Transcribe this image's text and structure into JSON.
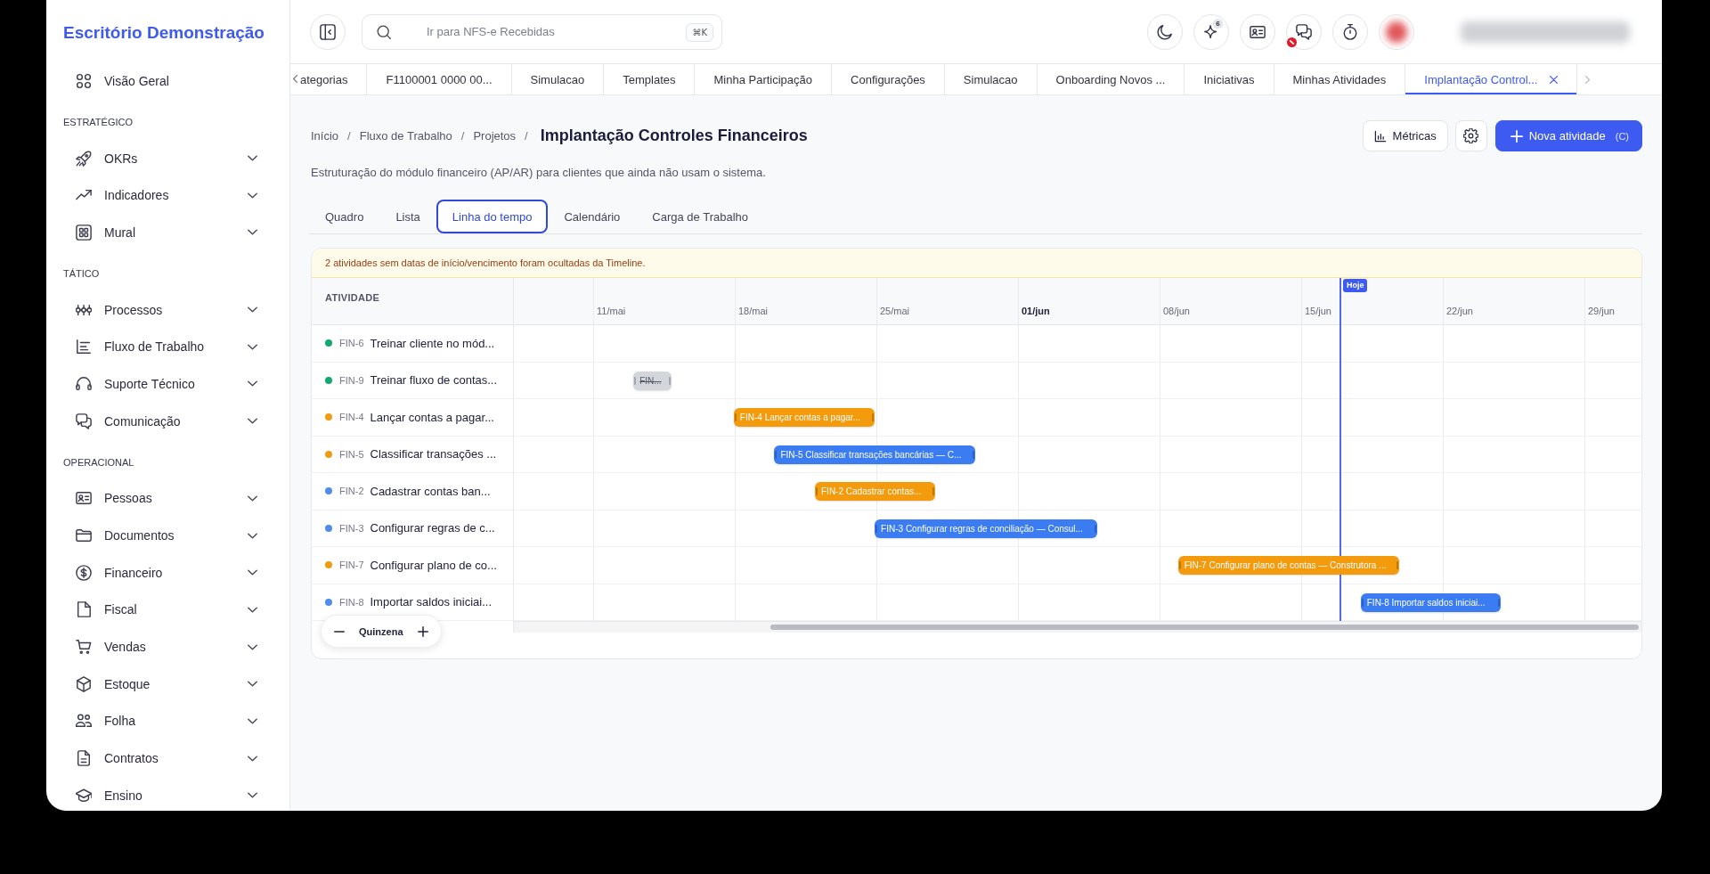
{
  "sidebar": {
    "title": "Escritório Demonstração",
    "groups": [
      {
        "items": [
          {
            "label": "Visão Geral"
          }
        ]
      },
      {
        "label": "ESTRATÉGICO",
        "items": [
          {
            "label": "OKRs",
            "expanded": false
          },
          {
            "label": "Indicadores",
            "expanded": false
          },
          {
            "label": "Mural",
            "expanded": false
          }
        ]
      },
      {
        "label": "TÁTICO",
        "items": [
          {
            "label": "Processos",
            "expanded": false
          },
          {
            "label": "Fluxo de Trabalho",
            "expanded": false
          },
          {
            "label": "Suporte Técnico",
            "expanded": false
          },
          {
            "label": "Comunicação",
            "expanded": false
          }
        ]
      },
      {
        "label": "OPERACIONAL",
        "items": [
          {
            "label": "Pessoas",
            "expanded": false
          },
          {
            "label": "Documentos",
            "expanded": false
          },
          {
            "label": "Financeiro",
            "expanded": false
          },
          {
            "label": "Fiscal",
            "expanded": false
          },
          {
            "label": "Vendas",
            "expanded": false
          },
          {
            "label": "Estoque",
            "expanded": false
          },
          {
            "label": "Folha",
            "expanded": false
          },
          {
            "label": "Contratos",
            "expanded": false
          },
          {
            "label": "Ensino",
            "expanded": false
          }
        ]
      }
    ]
  },
  "top_bar": {
    "search": {
      "placeholder": "Ir para NFS-e Recebidas",
      "shortcut": "⌘K"
    },
    "actions": [
      {
        "blocked": false
      },
      {
        "badge": "6",
        "blocked": false
      },
      {
        "blocked": false
      },
      {
        "blocked": true
      },
      {
        "blocked": false
      }
    ]
  },
  "open_tabs": [
    {
      "label": "ategorias",
      "selected": false
    },
    {
      "label": "F1100001 0000 00...",
      "selected": false
    },
    {
      "label": "Simulacao",
      "selected": false
    },
    {
      "label": "Templates",
      "selected": false
    },
    {
      "label": "Minha Participação",
      "selected": false
    },
    {
      "label": "Configurações",
      "selected": false
    },
    {
      "label": "Simulacao",
      "selected": false
    },
    {
      "label": "Onboarding Novos ...",
      "selected": false
    },
    {
      "label": "Iniciativas",
      "selected": false
    },
    {
      "label": "Minhas Atividades",
      "selected": false
    },
    {
      "label": "Implantação Control...",
      "selected": true
    }
  ],
  "page": {
    "breadcrumb": [
      {
        "label": "Início",
        "separator": "/"
      },
      {
        "label": "Fluxo de Trabalho",
        "separator": "/"
      },
      {
        "label": "Projetos",
        "separator": "/"
      }
    ],
    "title": "Implantação Controles Financeiros",
    "description": "Estruturação do módulo financeiro (AP/AR) para clientes que ainda não usam o sistema.",
    "metrics_button": "Métricas",
    "new_button": {
      "label": "Nova atividade",
      "shortcut": "(C)"
    }
  },
  "views": [
    {
      "label": "Quadro",
      "selected": false
    },
    {
      "label": "Lista",
      "selected": false
    },
    {
      "label": "Linha do tempo",
      "selected": true
    },
    {
      "label": "Calendário",
      "selected": false
    },
    {
      "label": "Carga de Trabalho",
      "selected": false
    }
  ],
  "timeline": {
    "notice": "2 atividades sem datas de início/vencimento foram ocultadas da Timeline.",
    "column_header": "ATIVIDADE",
    "weeks": [
      {
        "label": "11/mai",
        "highlighted": false
      },
      {
        "label": "18/mai",
        "highlighted": false
      },
      {
        "label": "25/mai",
        "highlighted": false
      },
      {
        "label": "01/jun",
        "highlighted": true
      },
      {
        "label": "08/jun",
        "highlighted": false
      },
      {
        "label": "15/jun",
        "highlighted": false
      },
      {
        "label": "22/jun",
        "highlighted": false
      },
      {
        "label": "29/jun",
        "highlighted": false
      }
    ],
    "today": {
      "label": "Hoje",
      "level": 0.733
    },
    "rows": [
      {
        "id": "FIN-6",
        "title": "Treinar cliente no mód...",
        "color": "#12a96e"
      },
      {
        "id": "FIN-9",
        "title": "Treinar fluxo de contas...",
        "color": "#12a96e",
        "bar": {
          "label": "FIN...",
          "color": "#d3d6db",
          "completed": true,
          "start": {
            "level": 0.106
          },
          "end": {
            "level": 0.14
          }
        }
      },
      {
        "id": "FIN-4",
        "title": "Lançar contas a pagar...",
        "color": "#f29a12",
        "bar": {
          "label": "FIN-4 Lançar contas a pagar...",
          "color": "#f39a0d",
          "completed": false,
          "start": {
            "level": 0.195
          },
          "end": {
            "level": 0.32
          }
        }
      },
      {
        "id": "FIN-5",
        "title": "Classificar transações ...",
        "color": "#f29a12",
        "bar": {
          "label": "FIN-5 Classificar transações bancárias — C...",
          "color": "#3b7cf2",
          "completed": false,
          "start": {
            "level": 0.231
          },
          "end": {
            "level": 0.409
          }
        }
      },
      {
        "id": "FIN-2",
        "title": "Cadastrar contas ban...",
        "color": "#4f8cf0",
        "bar": {
          "label": "FIN-2 Cadastrar contas...",
          "color": "#f39a0d",
          "completed": false,
          "start": {
            "level": 0.267
          },
          "end": {
            "level": 0.374
          }
        }
      },
      {
        "id": "FIN-3",
        "title": "Configurar regras de c...",
        "color": "#4f8cf0",
        "bar": {
          "label": "FIN-3 Configurar regras de conciliação — Consul...",
          "color": "#3b7cf2",
          "completed": false,
          "start": {
            "level": 0.32
          },
          "end": {
            "level": 0.517
          }
        }
      },
      {
        "id": "FIN-7",
        "title": "Configurar plano de co...",
        "color": "#f29a12",
        "bar": {
          "label": "FIN-7 Configurar plano de contas — Construtora ...",
          "color": "#f39a0d",
          "completed": false,
          "start": {
            "level": 0.589
          },
          "end": {
            "level": 0.785
          }
        }
      },
      {
        "id": "FIN-8",
        "title": "Importar saldos iniciai...",
        "color": "#4f8cf0",
        "bar": {
          "label": "FIN-8 Importar saldos iniciai...",
          "color": "#3b7cf2",
          "completed": false,
          "start": {
            "level": 0.751
          },
          "end": {
            "level": 0.875
          }
        }
      }
    ],
    "zoom": {
      "label": "Quinzena"
    }
  }
}
